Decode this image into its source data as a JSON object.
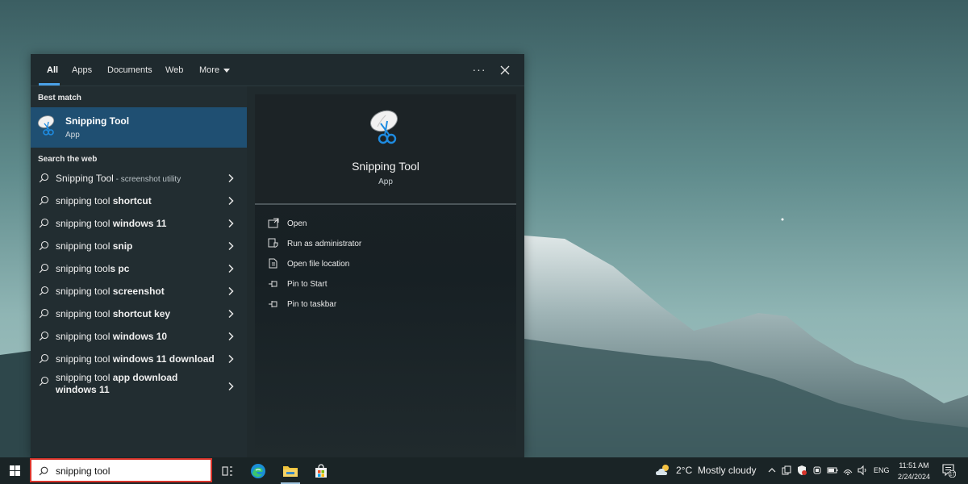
{
  "search_panel": {
    "tabs": [
      {
        "label": "All"
      },
      {
        "label": "Apps"
      },
      {
        "label": "Documents"
      },
      {
        "label": "Web"
      },
      {
        "label": "More"
      }
    ],
    "options_label": "···",
    "best_match_header": "Best match",
    "best_match": {
      "name": "Snipping Tool",
      "type": "App",
      "icon": "snipping-tool-icon"
    },
    "search_web_header": "Search the web",
    "web_results": [
      {
        "prefix": "Snipping Tool",
        "bold": "",
        "suffix": " - screenshot utility"
      },
      {
        "prefix": "snipping tool ",
        "bold": "shortcut",
        "suffix": ""
      },
      {
        "prefix": "snipping tool ",
        "bold": "windows 11",
        "suffix": ""
      },
      {
        "prefix": "snipping tool ",
        "bold": "snip",
        "suffix": ""
      },
      {
        "prefix": "snipping tool",
        "bold": "s pc",
        "suffix": ""
      },
      {
        "prefix": "snipping tool ",
        "bold": "screenshot",
        "suffix": ""
      },
      {
        "prefix": "snipping tool ",
        "bold": "shortcut key",
        "suffix": ""
      },
      {
        "prefix": "snipping tool ",
        "bold": "windows 10",
        "suffix": ""
      },
      {
        "prefix": "snipping tool ",
        "bold": "windows 11 download",
        "suffix": ""
      },
      {
        "prefix": "snipping tool ",
        "bold": "app download windows 11",
        "suffix": ""
      }
    ],
    "app_card": {
      "name": "Snipping Tool",
      "type": "App"
    },
    "actions": [
      {
        "label": "Open",
        "icon": "open-icon"
      },
      {
        "label": "Run as administrator",
        "icon": "shield-icon"
      },
      {
        "label": "Open file location",
        "icon": "file-location-icon"
      },
      {
        "label": "Pin to Start",
        "icon": "pin-icon"
      },
      {
        "label": "Pin to taskbar",
        "icon": "pin-icon"
      }
    ]
  },
  "taskbar": {
    "search_value": "snipping tool",
    "weather": {
      "temp": "2°C",
      "condition": "Mostly cloudy",
      "icon": "partly-cloudy-icon"
    },
    "language": "ENG",
    "time": "11:51 AM",
    "date": "2/24/2024",
    "notification_count": "17",
    "pinned_apps": [
      "task-view-icon",
      "edge-icon",
      "file-explorer-icon",
      "store-icon"
    ],
    "accent": "#4aa0e6",
    "highlight_border": "#d9342b"
  }
}
